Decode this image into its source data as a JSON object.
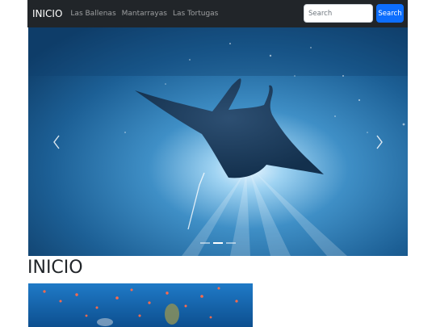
{
  "navbar": {
    "brand": "INICIO",
    "links": [
      "Las Ballenas",
      "Mantarrayas",
      "Las Tortugas"
    ],
    "search_placeholder": "Search",
    "search_button": "Search"
  },
  "carousel": {
    "prev_icon": "chevron-left-icon",
    "next_icon": "chevron-right-icon",
    "slide_count": 3,
    "active_slide": 1
  },
  "section": {
    "heading": "INICIO"
  },
  "colors": {
    "navbar_bg": "#212529",
    "primary": "#0d6efd",
    "ocean": "#1d6aa0"
  }
}
